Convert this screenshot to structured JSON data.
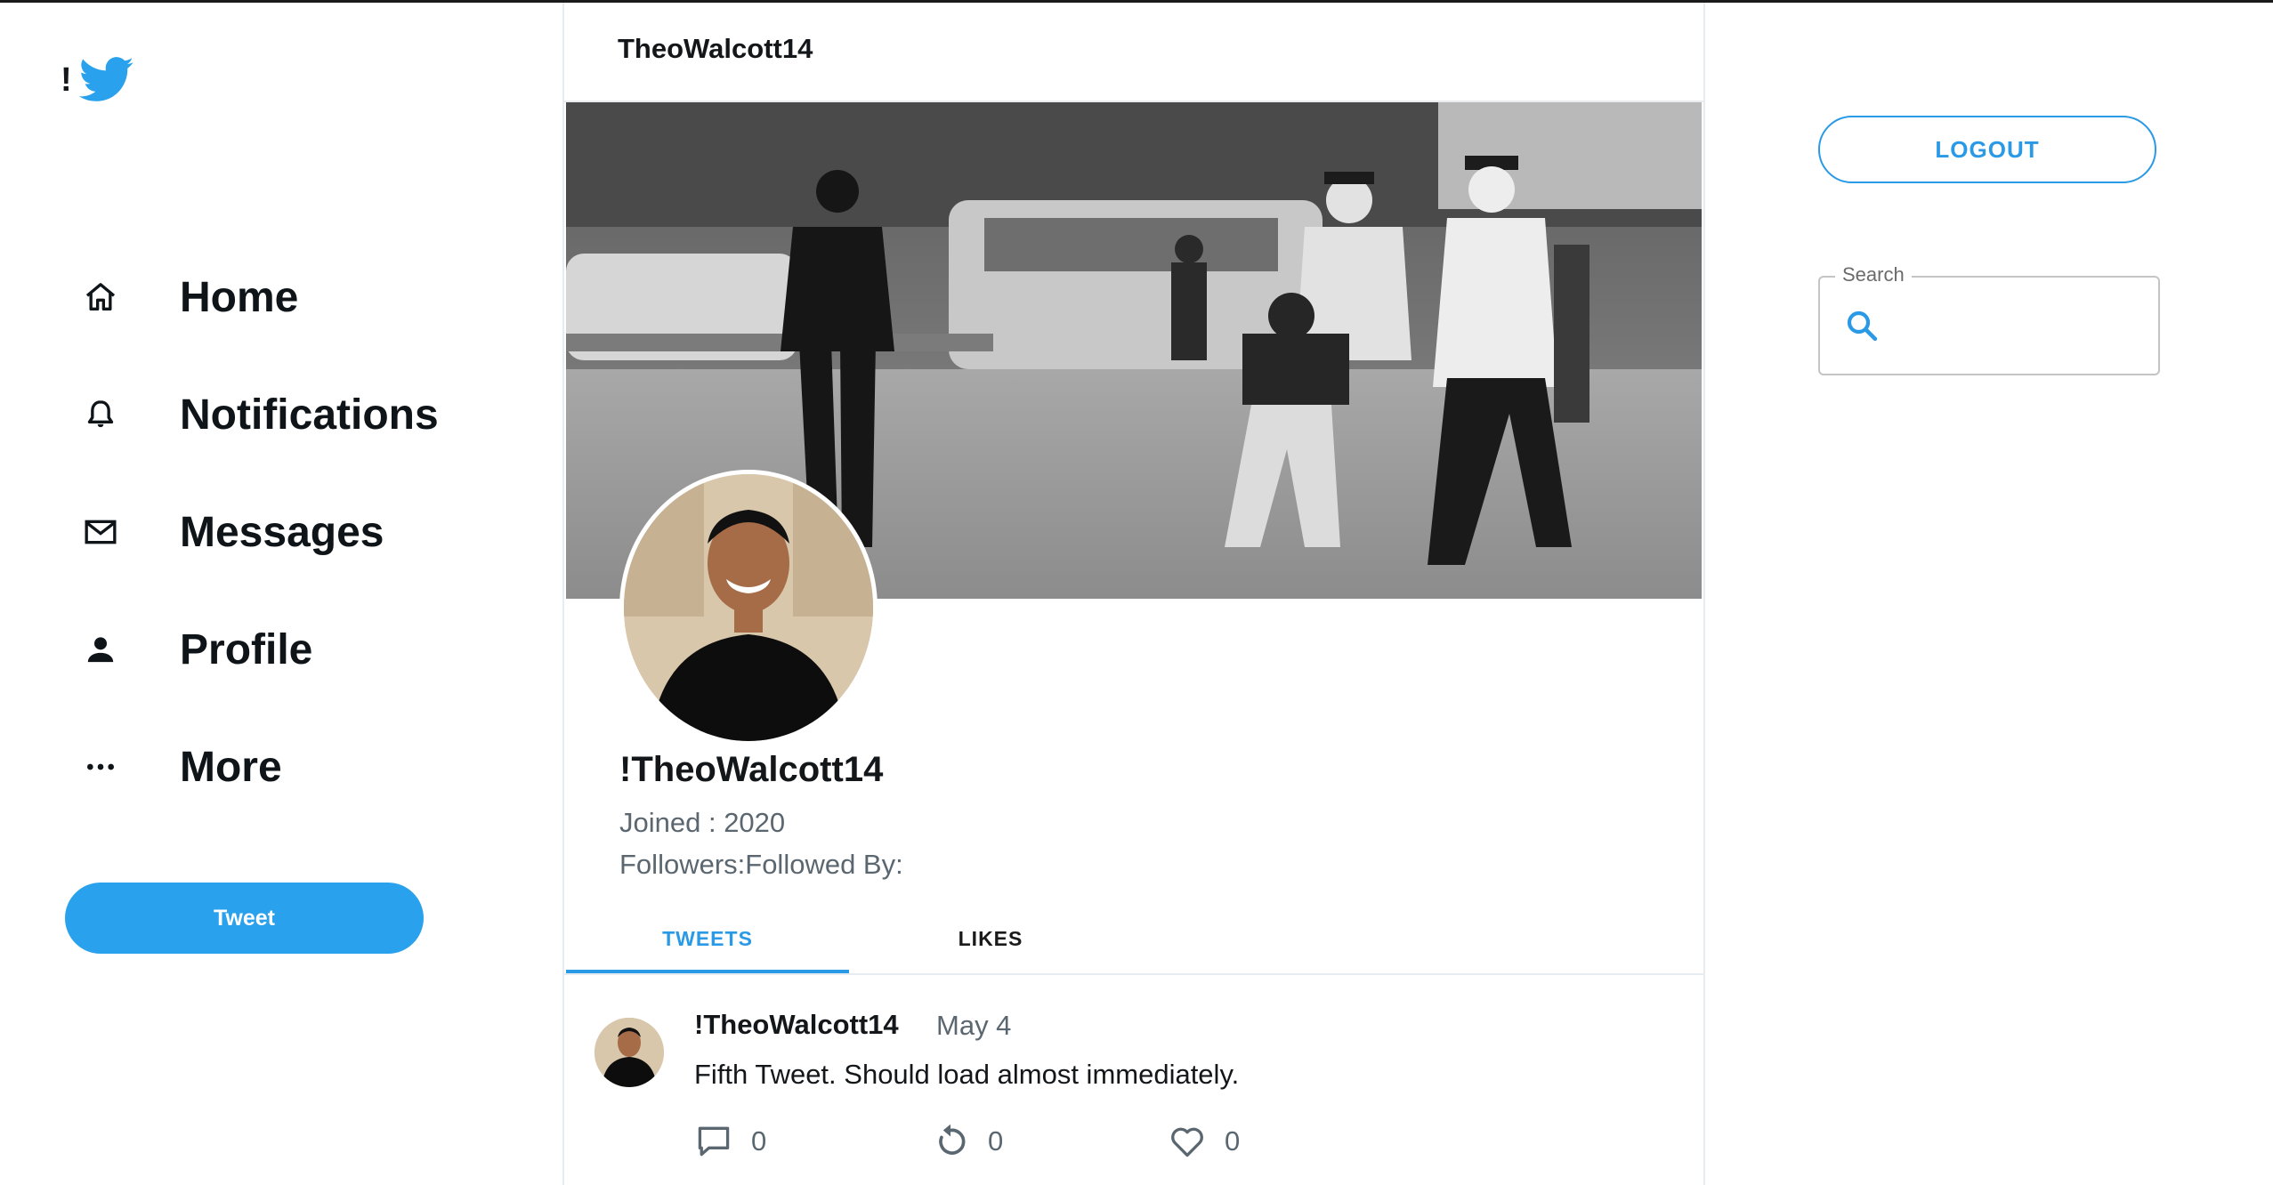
{
  "brand": {
    "prefix": "!",
    "logo_icon": "twitter-bird-icon",
    "accent": "#2aa1ec"
  },
  "nav": {
    "items": [
      {
        "label": "Home",
        "icon": "home-icon"
      },
      {
        "label": "Notifications",
        "icon": "bell-icon"
      },
      {
        "label": "Messages",
        "icon": "mail-icon"
      },
      {
        "label": "Profile",
        "icon": "person-icon"
      },
      {
        "label": "More",
        "icon": "more-icon"
      }
    ],
    "tweet_button": "Tweet"
  },
  "main": {
    "header_title": "TheoWalcott14",
    "profile": {
      "name": "!TheoWalcott14",
      "joined": "Joined : 2020",
      "followers": "Followers:Followed By:"
    },
    "tabs": [
      {
        "label": "TWEETS",
        "active": true
      },
      {
        "label": "LIKES",
        "active": false
      }
    ],
    "tweets": [
      {
        "author": "!TheoWalcott14",
        "date": "May 4",
        "text": "Fifth Tweet. Should load almost immediately.",
        "reply_count": "0",
        "retweet_count": "0",
        "like_count": "0"
      }
    ]
  },
  "right": {
    "logout_label": "LOGOUT",
    "search": {
      "label": "Search",
      "value": "",
      "placeholder": ""
    }
  },
  "colors": {
    "accent": "#2a99e6",
    "text": "#14171a",
    "muted": "#5b6770",
    "border": "#e6ecf0"
  }
}
